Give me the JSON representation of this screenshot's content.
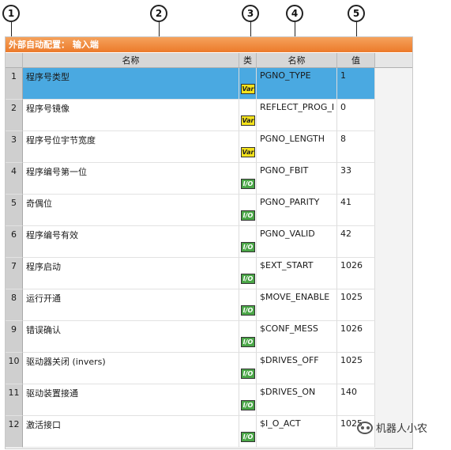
{
  "callouts": [
    "1",
    "2",
    "3",
    "4",
    "5"
  ],
  "window": {
    "title": "外部自动配置： 输入端"
  },
  "columns": [
    "名称",
    "类",
    "名称",
    "值"
  ],
  "rows": [
    {
      "num": "1",
      "name": "程序号类型",
      "type_icon": "Var",
      "var_name": "PGNO_TYPE",
      "value": "1",
      "selected": true
    },
    {
      "num": "2",
      "name": "程序号镜像",
      "type_icon": "Var",
      "var_name": "REFLECT_PROG_I",
      "value": "0"
    },
    {
      "num": "3",
      "name": "程序号位宇节宽度",
      "type_icon": "Var",
      "var_name": "PGNO_LENGTH",
      "value": "8"
    },
    {
      "num": "4",
      "name": "程序编号第一位",
      "type_icon": "I/O",
      "var_name": "PGNO_FBIT",
      "value": "33"
    },
    {
      "num": "5",
      "name": "奇偶位",
      "type_icon": "I/O",
      "var_name": "PGNO_PARITY",
      "value": "41"
    },
    {
      "num": "6",
      "name": "程序编号有效",
      "type_icon": "I/O",
      "var_name": "PGNO_VALID",
      "value": "42"
    },
    {
      "num": "7",
      "name": "程序启动",
      "type_icon": "I/O",
      "var_name": "$EXT_START",
      "value": "1026"
    },
    {
      "num": "8",
      "name": "运行开通",
      "type_icon": "I/O",
      "var_name": "$MOVE_ENABLE",
      "value": "1025"
    },
    {
      "num": "9",
      "name": "错误确认",
      "type_icon": "I/O",
      "var_name": "$CONF_MESS",
      "value": "1026"
    },
    {
      "num": "10",
      "name": "驱动器关闭 (invers)",
      "type_icon": "I/O",
      "var_name": "$DRIVES_OFF",
      "value": "1025"
    },
    {
      "num": "11",
      "name": "驱动装置接通",
      "type_icon": "I/O",
      "var_name": "$DRIVES_ON",
      "value": "140"
    },
    {
      "num": "12",
      "name": "激活接口",
      "type_icon": "I/O",
      "var_name": "$I_O_ACT",
      "value": "1025"
    }
  ],
  "watermark": {
    "text": "机器人小农"
  },
  "colors": {
    "title_bar": "#ec7a2a",
    "selected_row": "#4aa9e1",
    "var_icon": "#f4e21a",
    "io_icon": "#4aa647"
  }
}
